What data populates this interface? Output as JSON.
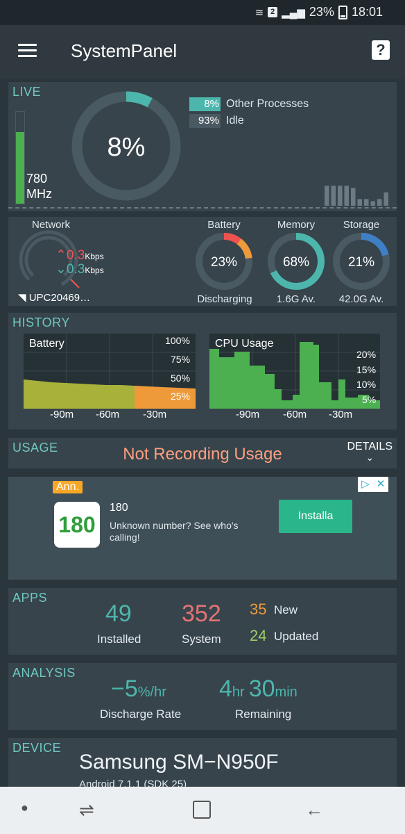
{
  "status_bar": {
    "battery_percent": "23%",
    "time": "18:01",
    "badge": "2",
    "icons": [
      "wifi-icon",
      "signal-icon",
      "battery-icon"
    ]
  },
  "app_bar": {
    "title": "SystemPanel",
    "menu_icon": "hamburger-icon",
    "help_glyph": "?"
  },
  "live": {
    "title": "LIVE",
    "cpu_percent_text": "8%",
    "cpu_fraction": 0.08,
    "mhz_value": "780",
    "mhz_unit": "MHz",
    "mhz_fill_fraction": 0.78,
    "legend": [
      {
        "value": "8%",
        "label": "Other Processes",
        "color": "#4db6ac"
      },
      {
        "value": "93%",
        "label": "Idle",
        "color": "#4a5a62"
      }
    ],
    "sparkline_heights": [
      0.9,
      0.9,
      0.9,
      0.9,
      0.8,
      0.3,
      0.3,
      0.2,
      0.3,
      0.6
    ]
  },
  "resources": {
    "network": {
      "title": "Network",
      "up_value": "0.3",
      "up_unit": "Kbps",
      "down_value": "0.3",
      "down_unit": "Kbps",
      "ssid": "UPC20469…"
    },
    "battery": {
      "title": "Battery",
      "value": "23%",
      "fraction": 0.23,
      "status": "Discharging"
    },
    "memory": {
      "title": "Memory",
      "value": "68%",
      "fraction": 0.68,
      "sub": "1.6G Av."
    },
    "storage": {
      "title": "Storage",
      "value": "21%",
      "fraction": 0.21,
      "sub": "42.0G Av."
    }
  },
  "history": {
    "title": "HISTORY",
    "battery_chart": {
      "label": "Battery",
      "yticks": [
        "100%",
        "75%",
        "50%",
        "25%"
      ],
      "xticks": [
        "-90m",
        "-60m",
        "-30m"
      ]
    },
    "cpu_chart": {
      "label": "CPU Usage",
      "yticks": [
        "20%",
        "15%",
        "10%",
        "5%"
      ],
      "xticks": [
        "-90m",
        "-60m",
        "-30m"
      ]
    }
  },
  "usage": {
    "title": "USAGE",
    "status": "Not Recording Usage",
    "details_label": "DETAILS"
  },
  "ad": {
    "badge": "Ann.",
    "icon_text": "180",
    "title": "180",
    "description": "Unknown number? See who's calling!",
    "button": "Installa"
  },
  "apps": {
    "title": "APPS",
    "installed_count": "49",
    "installed_label": "Installed",
    "system_count": "352",
    "system_label": "System",
    "new_count": "35",
    "new_label": "New",
    "updated_count": "24",
    "updated_label": "Updated"
  },
  "analysis": {
    "title": "ANALYSIS",
    "discharge_value": "−5",
    "discharge_unit": "%/hr",
    "discharge_label": "Discharge Rate",
    "remaining_hours": "4",
    "remaining_hours_unit": "hr",
    "remaining_minutes": "30",
    "remaining_minutes_unit": "min",
    "remaining_label": "Remaining"
  },
  "device": {
    "title": "DEVICE",
    "model": "Samsung SM−N950F",
    "android": "Android 7.1.1 (SDK 25)"
  },
  "colors": {
    "teal": "#4db6ac",
    "green": "#4caf50",
    "orange": "#ef9a3a",
    "red": "#ef5350",
    "blue": "#3f7fc6",
    "salmon": "#ff9f80",
    "pink": "#e57373",
    "olive": "#a8b23a"
  }
}
